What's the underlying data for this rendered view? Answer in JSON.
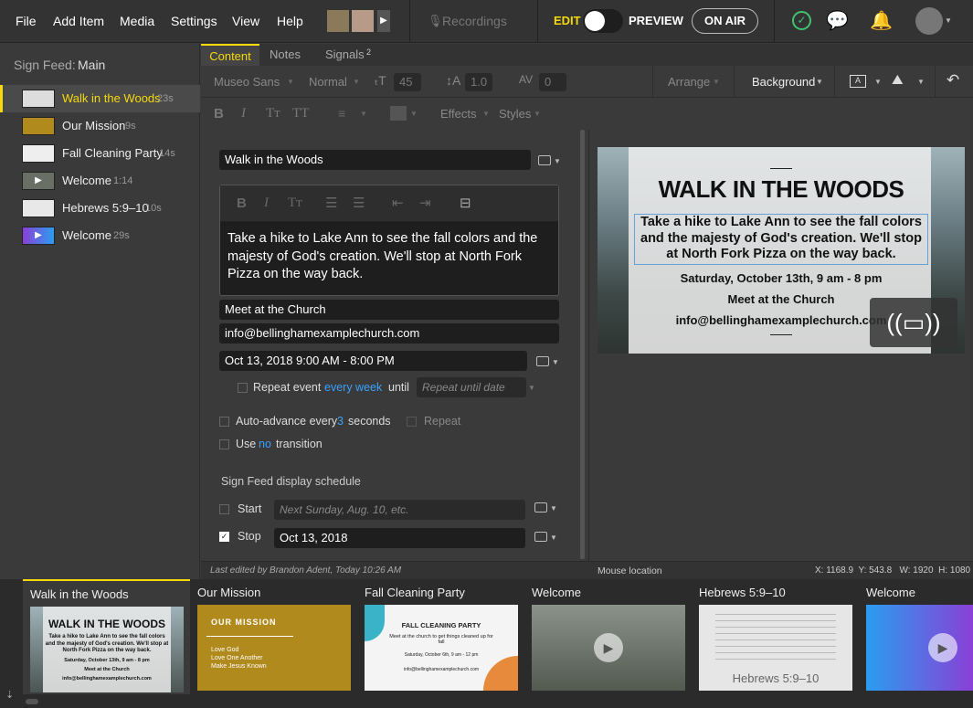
{
  "menu": {
    "file": "File",
    "add_item": "Add Item",
    "media": "Media",
    "settings": "Settings",
    "view": "View",
    "help": "Help"
  },
  "topbar": {
    "recordings": "Recordings",
    "edit": "EDIT",
    "preview": "PREVIEW",
    "on_air": "ON AIR"
  },
  "sidebar": {
    "heading_label": "Sign Feed:",
    "heading_value": "Main",
    "items": [
      {
        "name": "Walk in the Woods",
        "duration": "23s"
      },
      {
        "name": "Our Mission",
        "duration": "9s"
      },
      {
        "name": "Fall Cleaning Party",
        "duration": "14s"
      },
      {
        "name": "Welcome",
        "duration": "1:14"
      },
      {
        "name": "Hebrews 5:9–10",
        "duration": "10s"
      },
      {
        "name": "Welcome",
        "duration": "29s"
      }
    ]
  },
  "tabs": {
    "content": "Content",
    "notes": "Notes",
    "signals": "Signals",
    "signals_badge": "2"
  },
  "toolbar": {
    "font": "Museo Sans",
    "weight": "Normal",
    "size": "45",
    "line_height": "1.0",
    "spacing": "0",
    "arrange": "Arrange",
    "background": "Background",
    "effects": "Effects",
    "styles": "Styles"
  },
  "form": {
    "title": "Walk in the Woods",
    "body": "Take a hike to Lake Ann to see the fall colors and the majesty of God's creation. We'll stop at North Fork Pizza on the way back.",
    "location": "Meet at the Church",
    "email": "info@bellinghamexamplechurch.com",
    "datetime": "Oct 13, 2018 9:00 AM - 8:00 PM",
    "repeat_label": "Repeat event",
    "repeat_freq": "every week",
    "until": "until",
    "repeat_placeholder": "Repeat until date",
    "auto_advance_pre": "Auto-advance every",
    "auto_advance_num": "3",
    "auto_advance_post": "seconds",
    "repeat": "Repeat",
    "use": "Use",
    "transition_val": "no",
    "transition": "transition",
    "schedule_heading": "Sign Feed display schedule",
    "start_label": "Start",
    "start_placeholder": "Next Sunday, Aug. 10, etc.",
    "stop_label": "Stop",
    "stop_value": "Oct 13, 2018"
  },
  "status": {
    "last_edited": "Last edited by Brandon Adent, Today 10:26 AM",
    "mouse": "Mouse location",
    "coords": "X: 1168.9  Y: 543.8   W: 1920  H: 1080"
  },
  "slide": {
    "title": "WALK IN THE WOODS",
    "body": "Take a hike to Lake Ann to see the fall colors and the majesty of God's creation. We'll stop at North Fork Pizza on the way back.",
    "date": "Saturday, October 13th, 9 am - 8 pm",
    "location": "Meet at the Church",
    "email": "info@bellinghamexamplechurch.com"
  },
  "bottom": [
    {
      "label": "Walk in the Woods",
      "t1": "WALK IN THE WOODS",
      "t2": "Take a hike to Lake Ann to see the fall colors and the majesty of God's creation. We'll stop at North Fork Pizza on the way back.",
      "t3": "Saturday, October 13th, 9 am - 8 pm",
      "t4": "Meet at the Church",
      "t5": "info@bellinghamexamplechurch.com"
    },
    {
      "label": "Our Mission",
      "t1": "OUR MISSION",
      "t2": "Love God",
      "t3": "Love One Another",
      "t4": "Make Jesus Known"
    },
    {
      "label": "Fall Cleaning Party",
      "t1": "FALL CLEANING PARTY",
      "t2": "Meet at the church to get things cleaned up for fall",
      "t3": "Saturday, October 6th, 9 am - 12 pm",
      "t4": "info@bellinghamexamplechurch.com"
    },
    {
      "label": "Welcome"
    },
    {
      "label": "Hebrews 5:9–10",
      "t1": "Hebrews 5:9–10"
    },
    {
      "label": "Welcome"
    }
  ],
  "colors": {
    "accent": "#f5d90a",
    "blue": "#3aa0ff",
    "green": "#3ec46d"
  }
}
